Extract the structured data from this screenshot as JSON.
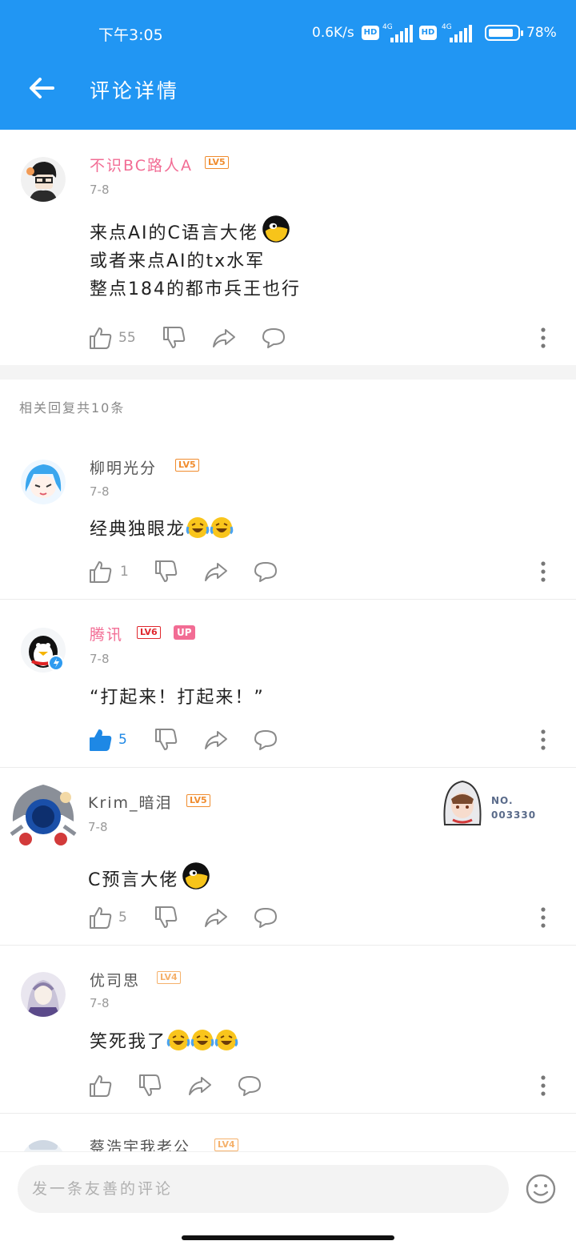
{
  "status_bar": {
    "time": "下午3:05",
    "net_speed": "0.6K/s",
    "hd_label": "HD",
    "signal_label": "4G",
    "battery": "78%"
  },
  "header": {
    "title": "评论详情"
  },
  "main_comment": {
    "user": "不识BC路人A",
    "level": "LV5",
    "date": "7-8",
    "lines": [
      "来点AI的C语言大佬",
      "或者来点AI的tx水军",
      "整点184的都市兵王也行"
    ],
    "likes": "55"
  },
  "replies_header": "相关回复共10条",
  "replies": [
    {
      "user": "柳明光分",
      "level": "LV5",
      "date": "7-8",
      "text": "经典独眼龙",
      "likes": "1"
    },
    {
      "user": "腾讯",
      "level": "LV6",
      "badge": "UP",
      "date": "7-8",
      "text": "“打起来！打起来！”",
      "likes": "5"
    },
    {
      "user": "Krim_暗泪",
      "level": "LV5",
      "date": "7-8",
      "text": "C预言大佬",
      "likes": "5",
      "fan_badge": {
        "label": "NO.",
        "number": "003330"
      }
    },
    {
      "user": "优司思",
      "level": "LV4",
      "date": "7-8",
      "text": "笑死我了",
      "likes": ""
    },
    {
      "user": "蔡浩宇我老公",
      "level": "LV4"
    }
  ],
  "input": {
    "placeholder": "发一条友善的评论"
  },
  "icons": {
    "back": "arrow-left-icon",
    "like": "thumbs-up-icon",
    "dislike": "thumbs-down-icon",
    "share": "share-icon",
    "reply": "comment-icon",
    "more": "more-vertical-icon",
    "emoji": "smile-icon"
  },
  "colors": {
    "accent": "#2196f3",
    "pink_name": "#f26c94",
    "liked": "#1e88e5"
  }
}
